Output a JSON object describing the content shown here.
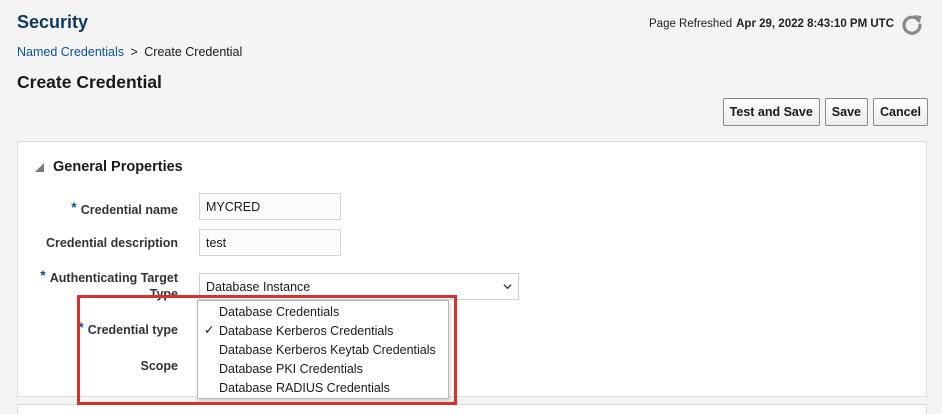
{
  "header": {
    "app_title": "Security",
    "refresh_label": "Page Refreshed",
    "refresh_timestamp": "Apr 29, 2022 8:43:10 PM UTC",
    "refresh_icon": "refresh-icon"
  },
  "breadcrumb": {
    "parent": "Named Credentials",
    "separator": ">",
    "current": "Create Credential"
  },
  "page_title": "Create Credential",
  "actions": {
    "test_save": "Test and Save",
    "save": "Save",
    "cancel": "Cancel"
  },
  "section": {
    "title": "General Properties",
    "icon": "collapse-triangle-icon"
  },
  "form": {
    "required_mark": "*",
    "credential_name_label": "Credential name",
    "credential_name_value": "MYCRED",
    "credential_description_label": "Credential description",
    "credential_description_value": "test",
    "target_type_label_line1": "Authenticating Target",
    "target_type_label_line2": "Type",
    "target_type_value": "Database Instance",
    "credential_type_label": "Credential type",
    "scope_label": "Scope"
  },
  "dropdown": {
    "check_mark": "✓",
    "options": [
      "Database Credentials",
      "Database Kerberos Credentials",
      "Database Kerberos Keytab Credentials",
      "Database PKI Credentials",
      "Database RADIUS Credentials"
    ],
    "selected_index": 1
  },
  "colors": {
    "title_blue": "#0b3a5b",
    "link_blue": "#0b5394",
    "highlight_red": "#d6322a",
    "page_bg": "#f4f4f4"
  }
}
